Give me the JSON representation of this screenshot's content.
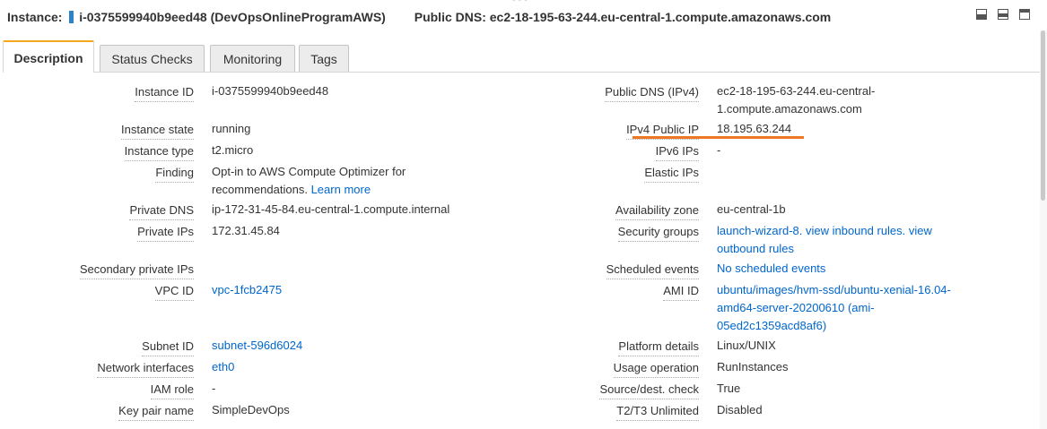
{
  "header": {
    "instance_label": "Instance:",
    "instance_value": "i-0375599940b9eed48 (DevOpsOnlineProgramAWS)",
    "dns_label": "Public DNS:",
    "dns_value": "ec2-18-195-63-244.eu-central-1.compute.amazonaws.com"
  },
  "tabs": [
    {
      "label": "Description",
      "active": true
    },
    {
      "label": "Status Checks"
    },
    {
      "label": "Monitoring"
    },
    {
      "label": "Tags"
    }
  ],
  "left": {
    "instance_id": {
      "label": "Instance ID",
      "value": "i-0375599940b9eed48"
    },
    "instance_state": {
      "label": "Instance state",
      "value": "running"
    },
    "instance_type": {
      "label": "Instance type",
      "value": "t2.micro"
    },
    "finding": {
      "label": "Finding",
      "line1": "Opt-in to AWS Compute Optimizer for",
      "line2": "recommendations.",
      "link": "Learn more"
    },
    "private_dns": {
      "label": "Private DNS",
      "value": "ip-172-31-45-84.eu-central-1.compute.internal"
    },
    "private_ips": {
      "label": "Private IPs",
      "value": "172.31.45.84"
    },
    "secondary_private_ips": {
      "label": "Secondary private IPs",
      "value": ""
    },
    "vpc_id": {
      "label": "VPC ID",
      "value": "vpc-1fcb2475"
    },
    "subnet_id": {
      "label": "Subnet ID",
      "value": "subnet-596d6024"
    },
    "network_interfaces": {
      "label": "Network interfaces",
      "value": "eth0"
    },
    "iam_role": {
      "label": "IAM role",
      "value": "-"
    },
    "key_pair_name": {
      "label": "Key pair name",
      "value": "SimpleDevOps"
    }
  },
  "right": {
    "public_dns_ipv4": {
      "label": "Public DNS (IPv4)",
      "line1": "ec2-18-195-63-244.eu-central-",
      "line2": "1.compute.amazonaws.com"
    },
    "ipv4_public_ip": {
      "label": "IPv4 Public IP",
      "value": "18.195.63.244"
    },
    "ipv6_ips": {
      "label": "IPv6 IPs",
      "value": "-"
    },
    "elastic_ips": {
      "label": "Elastic IPs",
      "value": ""
    },
    "availability_zone": {
      "label": "Availability zone",
      "value": "eu-central-1b"
    },
    "security_groups": {
      "label": "Security groups",
      "line1": "launch-wizard-8. view inbound rules. view",
      "line2": "outbound rules"
    },
    "scheduled_events": {
      "label": "Scheduled events",
      "value": "No scheduled events"
    },
    "ami_id": {
      "label": "AMI ID",
      "line1": "ubuntu/images/hvm-ssd/ubuntu-xenial-16.04-",
      "line2": "amd64-server-20200610 (ami-",
      "line3": "05ed2c1359acd8af6)"
    },
    "platform_details": {
      "label": "Platform details",
      "value": "Linux/UNIX"
    },
    "usage_operation": {
      "label": "Usage operation",
      "value": "RunInstances"
    },
    "source_dest_check": {
      "label": "Source/dest. check",
      "value": "True"
    },
    "t2t3_unlimited": {
      "label": "T2/T3 Unlimited",
      "value": "Disabled"
    }
  },
  "colors": {
    "accent_tab": "#F5A623",
    "link": "#0066cc",
    "highlight_underline": "#EE7722",
    "instance_marker": "#2E83C4"
  }
}
